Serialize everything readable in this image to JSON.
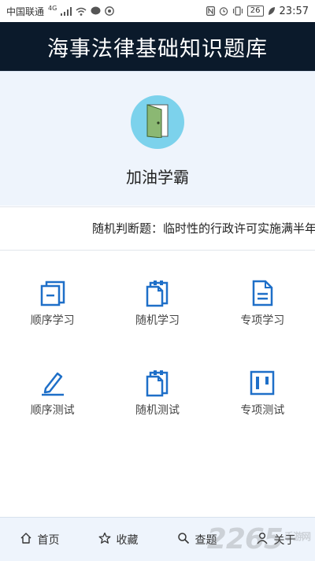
{
  "status_bar": {
    "carrier": "中国联通",
    "network": "4G",
    "battery": "26",
    "time": "23:57"
  },
  "header": {
    "title": "海事法律基础知识题库"
  },
  "hero": {
    "greeting": "加油学霸"
  },
  "marquee": {
    "text": "随机判断题：临时性的行政许可实施满半年"
  },
  "menu": {
    "items": [
      {
        "label": "顺序学习",
        "icon": "book-stack-icon"
      },
      {
        "label": "随机学习",
        "icon": "clipboard-copy-icon"
      },
      {
        "label": "专项学习",
        "icon": "document-icon"
      },
      {
        "label": "顺序测试",
        "icon": "pencil-icon"
      },
      {
        "label": "随机测试",
        "icon": "clipboard-copy-icon"
      },
      {
        "label": "专项测试",
        "icon": "board-icon"
      }
    ]
  },
  "bottom_nav": {
    "items": [
      {
        "label": "首页",
        "icon": "home-icon"
      },
      {
        "label": "收藏",
        "icon": "star-icon"
      },
      {
        "label": "查题",
        "icon": "search-icon"
      },
      {
        "label": "关于",
        "icon": "user-icon"
      }
    ]
  },
  "watermark": {
    "text": "2265",
    "suffix": "手游网"
  },
  "colors": {
    "header_bg": "#0b1a2b",
    "hero_bg": "#eef4fc",
    "icon_blue": "#1e6fc8",
    "avatar_bg": "#7cd2ec"
  }
}
